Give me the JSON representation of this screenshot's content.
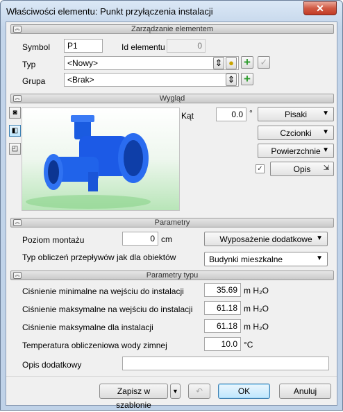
{
  "window": {
    "title": "Właściwości elementu: Punkt przyłączenia instalacji",
    "close": "✕"
  },
  "sections": {
    "manage": "Zarządzanie elementem",
    "look": "Wygląd",
    "params": "Parametry",
    "type_params": "Parametry typu"
  },
  "manage": {
    "symbol_label": "Symbol",
    "symbol_value": "P1",
    "id_label": "Id elementu",
    "id_value": "0",
    "type_label": "Typ",
    "type_value": "<Nowy>",
    "group_label": "Grupa",
    "group_value": "<Brak>"
  },
  "look": {
    "angle_label": "Kąt",
    "angle_value": "0.0",
    "angle_unit": "°",
    "pens": "Pisaki",
    "fonts": "Czcionki",
    "surfaces": "Powierzchnie",
    "desc_checked": true,
    "desc_button": "Opis"
  },
  "params": {
    "mount_label": "Poziom montażu",
    "mount_value": "0",
    "mount_unit": "cm",
    "extra_equipment": "Wyposażenie dodatkowe",
    "flow_label": "Typ obliczeń przepływów jak dla obiektów",
    "flow_value": "Budynki mieszkalne"
  },
  "type_params": {
    "rows": [
      {
        "label": "Ciśnienie minimalne na wejściu do instalacji",
        "value": "35.69",
        "unit": "m H₂O"
      },
      {
        "label": "Ciśnienie maksymalne na wejściu do instalacji",
        "value": "61.18",
        "unit": "m H₂O"
      },
      {
        "label": "Ciśnienie maksymalne dla instalacji",
        "value": "61.18",
        "unit": "m H₂O"
      },
      {
        "label": "Temperatura obliczeniowa wody zimnej",
        "value": "10.0",
        "unit": "°C"
      }
    ],
    "desc_label": "Opis dodatkowy",
    "desc_value": ""
  },
  "footer": {
    "save_template": "Zapisz w szablonie",
    "ok": "OK",
    "cancel": "Anuluj"
  }
}
